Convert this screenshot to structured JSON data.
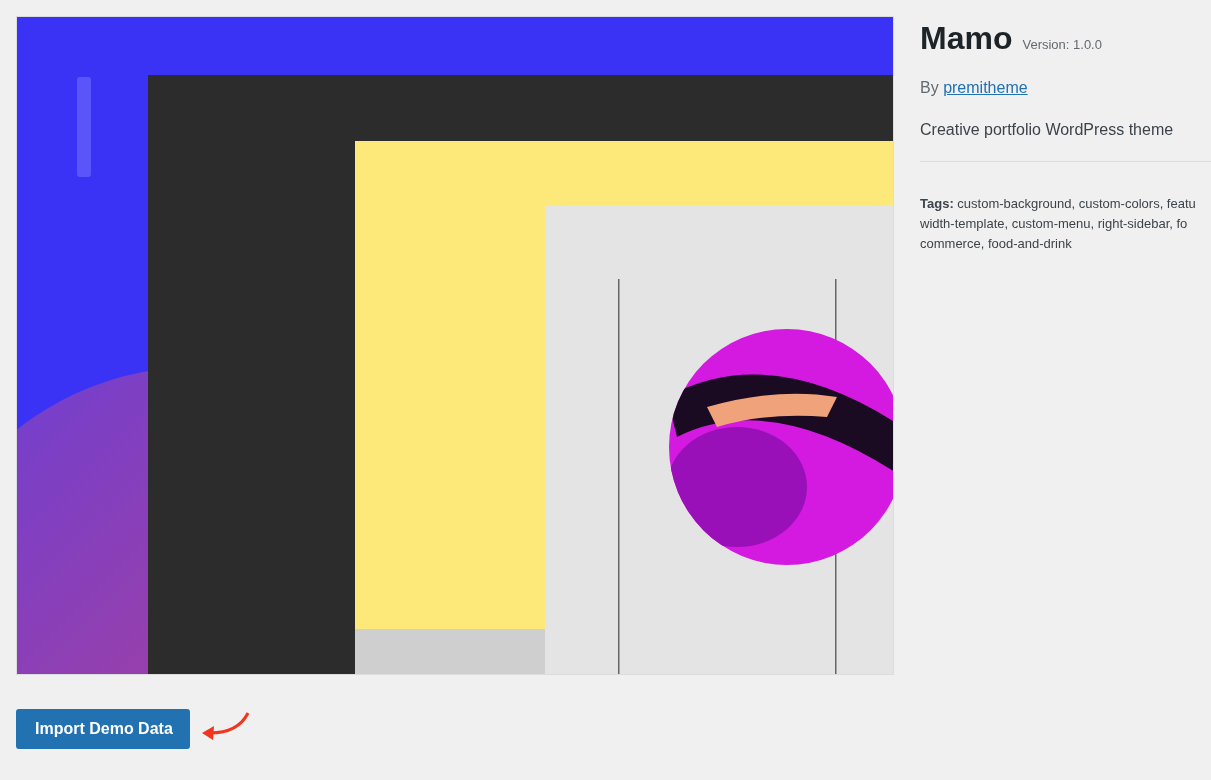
{
  "theme": {
    "name": "Mamo",
    "version": "Version: 1.0.0",
    "by": "By",
    "author": "premitheme",
    "description": "Creative portfolio WordPress theme",
    "tags": [
      "**Tags:** custom-background, custom-colors, featu",
      "width-template, custom-menu, right-sidebar, fo",
      "commerce, food-and-drink"
    ]
  },
  "import_button": {
    "label": "Import Demo Data"
  }
}
